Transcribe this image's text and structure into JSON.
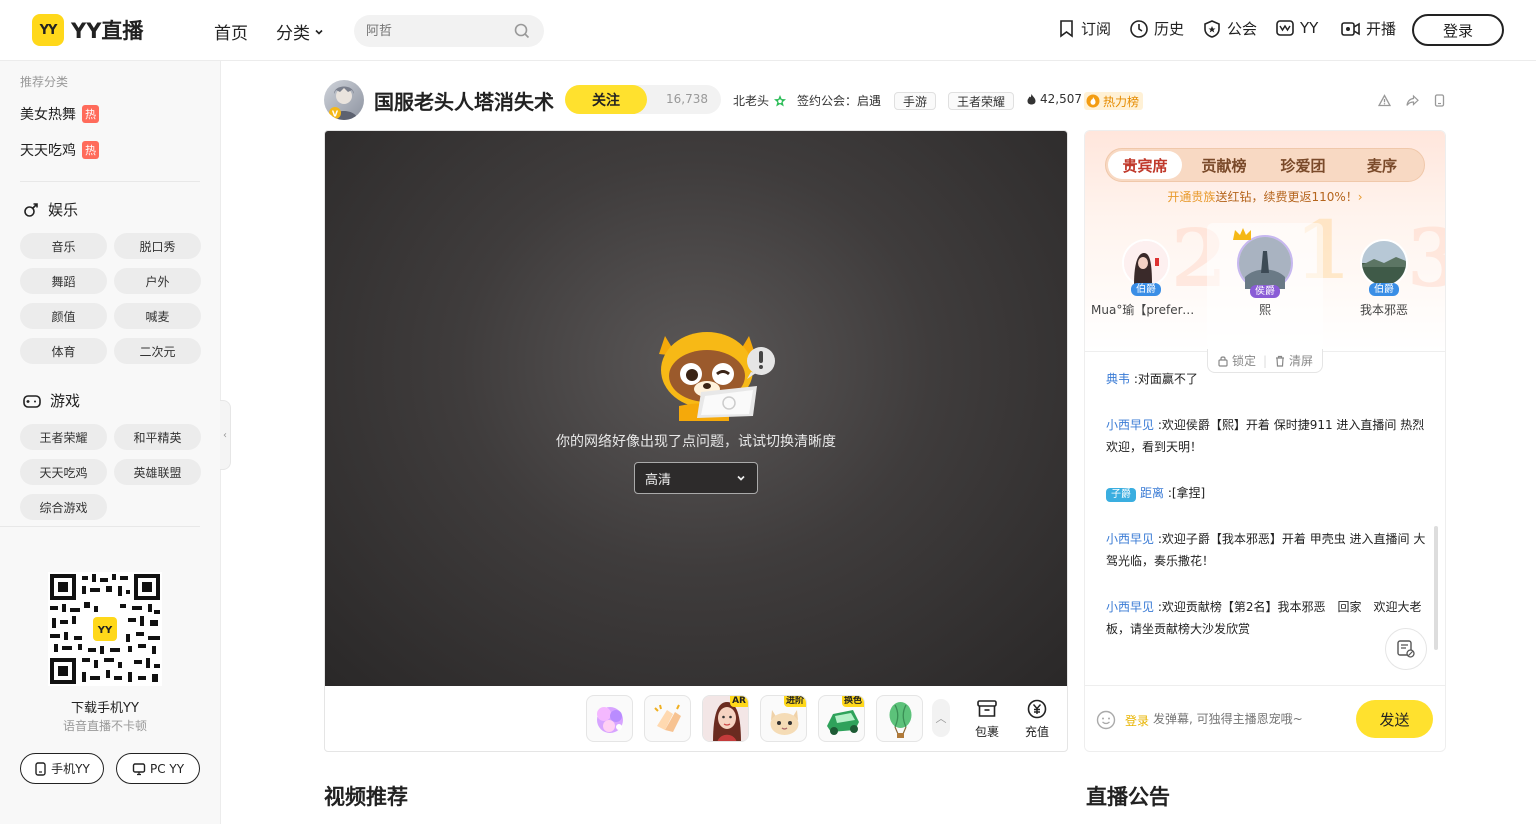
{
  "header": {
    "logo_badge": "YY",
    "logo_text": "YY直播",
    "nav": {
      "home": "首页",
      "category": "分类"
    },
    "search_placeholder": "阿哲",
    "links": {
      "subscribe": "订阅",
      "history": "历史",
      "guild": "公会",
      "yy": "YY",
      "broadcast": "开播"
    },
    "login": "登录"
  },
  "sidebar": {
    "recommend_title": "推荐分类",
    "hot_items": [
      {
        "label": "美女热舞",
        "badge": "热"
      },
      {
        "label": "天天吃鸡",
        "badge": "热"
      }
    ],
    "entertainment": {
      "title": "娱乐",
      "items": [
        "音乐",
        "脱口秀",
        "舞蹈",
        "户外",
        "颜值",
        "喊麦",
        "体育",
        "二次元"
      ]
    },
    "games": {
      "title": "游戏",
      "items": [
        "王者荣耀",
        "和平精英",
        "天天吃鸡",
        "英雄联盟",
        "综合游戏"
      ]
    },
    "download_title": "下载手机YY",
    "download_sub": "语音直播不卡顿",
    "btn_mobile": "手机YY",
    "btn_pc": "PC YY",
    "qr_label": "YY"
  },
  "room": {
    "title": "国服老头人塔消失术",
    "follow": "关注",
    "followers": "16,738",
    "host": "北老头",
    "guild": "签约公会：启遇",
    "tags": [
      "手游",
      "王者荣耀"
    ],
    "heat": "42,507",
    "hot_rank": "热力榜"
  },
  "player": {
    "error": "你的网络好像出现了点问题，试试切换清晰度",
    "quality": "高清",
    "gift_badges": {
      "g3": "AR",
      "g4": "进阶",
      "g5": "换色"
    },
    "bag": "包裹",
    "recharge": "充值"
  },
  "panel": {
    "tabs": [
      "贵宾席",
      "贡献榜",
      "珍爱团",
      "麦序"
    ],
    "tip_highlight": "开通贵族",
    "tip_rest": "送红钻，续费更返110%！",
    "seats": [
      {
        "rank": "伯爵",
        "name": "Mua°瑜【prefere…",
        "num": "2"
      },
      {
        "rank": "侯爵",
        "name": "熙",
        "num": "1"
      },
      {
        "rank": "伯爵",
        "name": "我本邪恶",
        "num": "3"
      }
    ],
    "lock": "锁定",
    "clear": "清屏",
    "messages": [
      {
        "user": "典韦",
        "text": "对面赢不了"
      },
      {
        "user": "小西早见",
        "text": "欢迎侯爵【熙】开着 保时捷911 进入直播间 热烈欢迎，看到天明！"
      },
      {
        "badge": "子爵",
        "user": "距离",
        "text": "[拿捏]"
      },
      {
        "user": "小西早见",
        "text": "欢迎子爵【我本邪恶】开着 甲壳虫 进入直播间 大驾光临，奏乐撒花！"
      },
      {
        "user": "小西早见",
        "text": "欢迎贡献榜【第2名】我本邪恶　回家　欢迎大老板，请坐贡献榜大沙发欣赏"
      }
    ],
    "login_link": "登录",
    "input_placeholder": "发弹幕, 可独得主播恩宠哦~",
    "send": "发送"
  },
  "sections": {
    "videos": "视频推荐",
    "notice": "直播公告"
  },
  "colors": {
    "brand_yellow": "#ffe12e",
    "hot_red": "#ff6b5b",
    "chat_user": "#3a7bd5"
  }
}
